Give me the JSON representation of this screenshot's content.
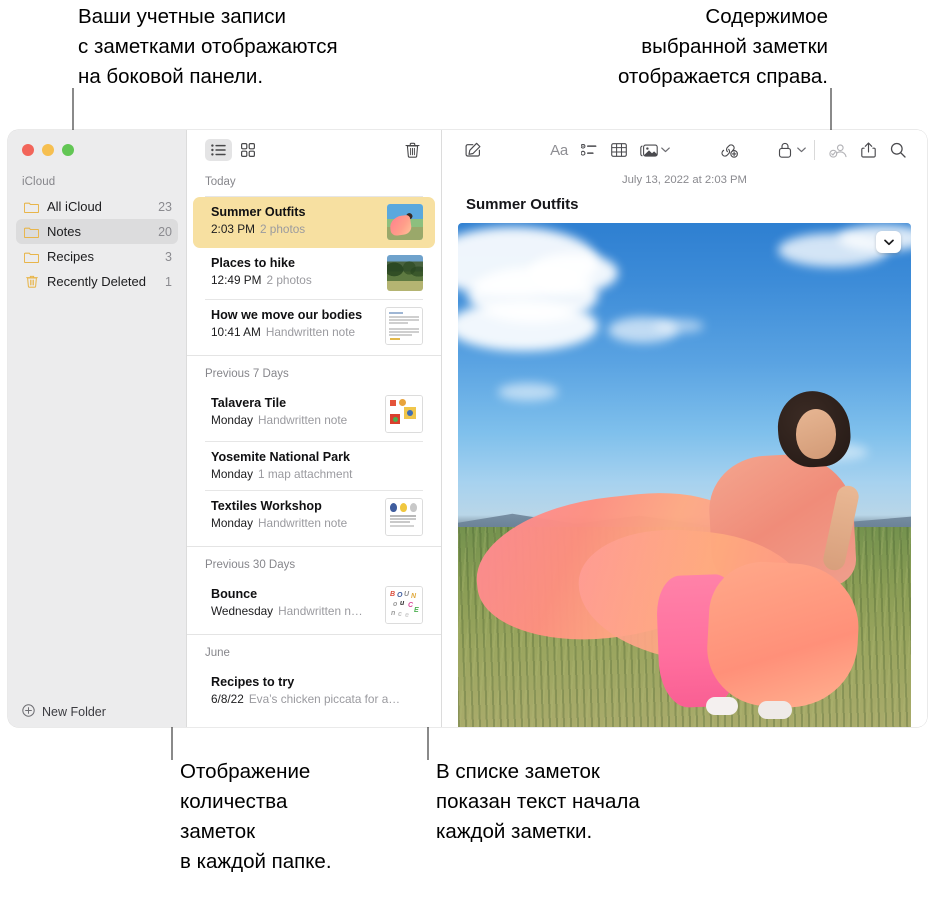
{
  "callouts": {
    "top_left": "Ваши учетные записи\nс заметками отображаются\nна боковой панели.",
    "top_right": "Содержимое\nвыбранной заметки\nотображается справа.",
    "bottom_left": "Отображение\nколичества\nзаметок\nв каждой папке.",
    "bottom_right": "В списке заметок\nпоказан текст начала\nкаждой заметки."
  },
  "window": {
    "sidebar": {
      "account_label": "iCloud",
      "folders": [
        {
          "icon": "folder-icon",
          "label": "All iCloud",
          "count": "23",
          "selected": false
        },
        {
          "icon": "folder-icon",
          "label": "Notes",
          "count": "20",
          "selected": true
        },
        {
          "icon": "folder-icon",
          "label": "Recipes",
          "count": "3",
          "selected": false
        },
        {
          "icon": "trash-icon",
          "label": "Recently Deleted",
          "count": "1",
          "selected": false
        }
      ],
      "new_folder_label": "New Folder",
      "new_folder_icon": "plus-circle-icon"
    },
    "notelist": {
      "toolbar": {
        "list_view_icon": "list-view-icon",
        "gallery_view_icon": "gallery-view-icon",
        "delete_icon": "trash-icon"
      },
      "groups": [
        {
          "title": "Today",
          "notes": [
            {
              "title": "Summer Outfits",
              "time": "2:03 PM",
              "snippet": "2 photos",
              "thumb": "summer-outfit-photo",
              "selected": true
            },
            {
              "title": "Places to hike",
              "time": "12:49 PM",
              "snippet": "2 photos",
              "thumb": "hike-photo",
              "selected": false
            },
            {
              "title": "How we move our bodies",
              "time": "10:41 AM",
              "snippet": "Handwritten note",
              "thumb": "handwritten-doc",
              "selected": false
            }
          ]
        },
        {
          "title": "Previous 7 Days",
          "notes": [
            {
              "title": "Talavera Tile",
              "time": "Monday",
              "snippet": "Handwritten note",
              "thumb": "tile-sketch",
              "selected": false
            },
            {
              "title": "Yosemite National Park",
              "time": "Monday",
              "snippet": "1 map attachment",
              "thumb": "none",
              "selected": false
            },
            {
              "title": "Textiles Workshop",
              "time": "Monday",
              "snippet": "Handwritten note",
              "thumb": "textiles-sketch",
              "selected": false
            }
          ]
        },
        {
          "title": "Previous 30 Days",
          "notes": [
            {
              "title": "Bounce",
              "time": "Wednesday",
              "snippet": "Handwritten n…",
              "thumb": "bounce-lettering",
              "selected": false
            }
          ]
        },
        {
          "title": "June",
          "notes": [
            {
              "title": "Recipes to try",
              "time": "6/8/22",
              "snippet": "Eva’s chicken piccata for a…",
              "thumb": "none",
              "selected": false
            }
          ]
        }
      ]
    },
    "detail": {
      "toolbar": {
        "compose_icon": "compose-icon",
        "format_label": "Aa",
        "checklist_icon": "checklist-icon",
        "table_icon": "table-icon",
        "media_icon": "media-icon",
        "media_chevron_icon": "chevron-down-icon",
        "link_icon": "add-link-icon",
        "lock_icon": "lock-icon",
        "lock_chevron_icon": "chevron-down-icon",
        "collaborate_icon": "add-people-icon",
        "share_icon": "share-icon",
        "search_icon": "search-icon"
      },
      "date": "July 13, 2022 at 2:03 PM",
      "title": "Summer Outfits",
      "photo_menu_icon": "chevron-down-icon",
      "photo_alt": "woman-in-pink-dress-by-river"
    }
  },
  "colors": {
    "selected_note": "#f7e0a1",
    "sidebar_bg": "#ececed",
    "sidebar_selected": "#dcdcdd",
    "folder_icon": "#e8b54a",
    "muted_text": "#8a8a8f",
    "leader_line": "#8a8a8a"
  }
}
